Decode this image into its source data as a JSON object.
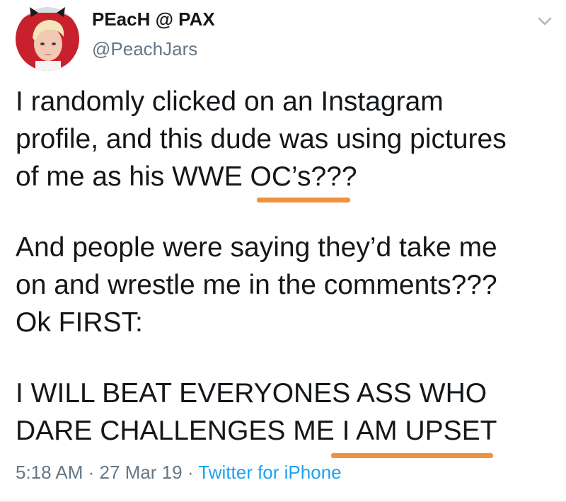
{
  "author": {
    "display_name": "PEacH @ PAX",
    "handle": "@PeachJars"
  },
  "tweet": {
    "paragraphs": [
      {
        "lines": [
          "I randomly clicked on an Instagram",
          "profile, and this dude was using pictures",
          "of me as his WWE OC’s???"
        ]
      },
      {
        "lines": [
          "And people were saying they’d take me",
          "on and wrestle me in the comments???",
          "Ok FIRST:"
        ]
      },
      {
        "lines": [
          "I WILL BEAT EVERYONES ASS WHO",
          "DARE CHALLENGES ME I AM UPSET"
        ]
      }
    ],
    "time": "5:18 AM",
    "separator": "·",
    "date": "27 Mar 19",
    "source": "Twitter for iPhone"
  },
  "icons": {
    "menu": "chevron-down-icon",
    "avatar": "avatar"
  },
  "colors": {
    "text": "#14171a",
    "secondary": "#657786",
    "link": "#1da1f2",
    "highlight_underline": "#f0913f"
  }
}
